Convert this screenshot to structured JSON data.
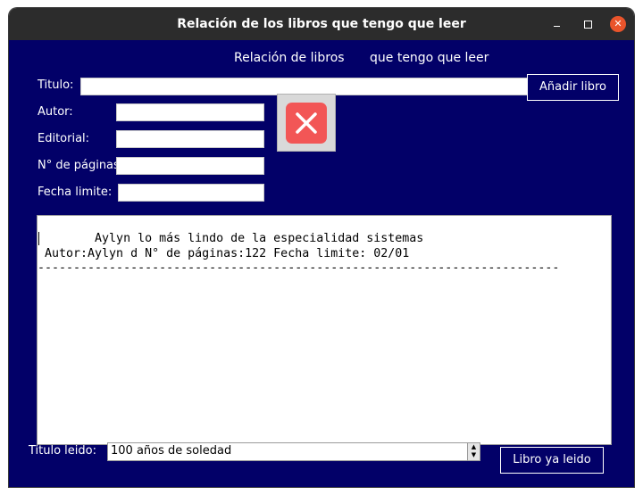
{
  "window": {
    "title": "Relación de los libros que tengo que leer"
  },
  "header": {
    "left": "Relación de libros",
    "right": "que tengo que leer"
  },
  "form": {
    "titulo_label": "Titulo:",
    "autor_label": "Autor:",
    "editorial_label": "Editorial:",
    "paginas_label": "N° de páginas",
    "fecha_label": "Fecha limite:",
    "titulo_value": "",
    "autor_value": "",
    "editorial_value": "",
    "paginas_value": "",
    "fecha_value": ""
  },
  "buttons": {
    "add": "Añadir libro",
    "delete_icon": "close-x-icon",
    "read": "Libro ya leido"
  },
  "list": {
    "lines": [
      "        Aylyn lo más lindo de la especialidad sistemas",
      " Autor:Aylyn d N° de páginas:122 Fecha limite: 02/01",
      "-------------------------------------------------------------------------"
    ]
  },
  "read_section": {
    "label": "Titulo leido:",
    "selected": "100 años de soledad"
  },
  "colors": {
    "background": "#020068",
    "titlebar": "#2c2c2c",
    "close": "#e9542b",
    "delete_button": "#f25656"
  }
}
